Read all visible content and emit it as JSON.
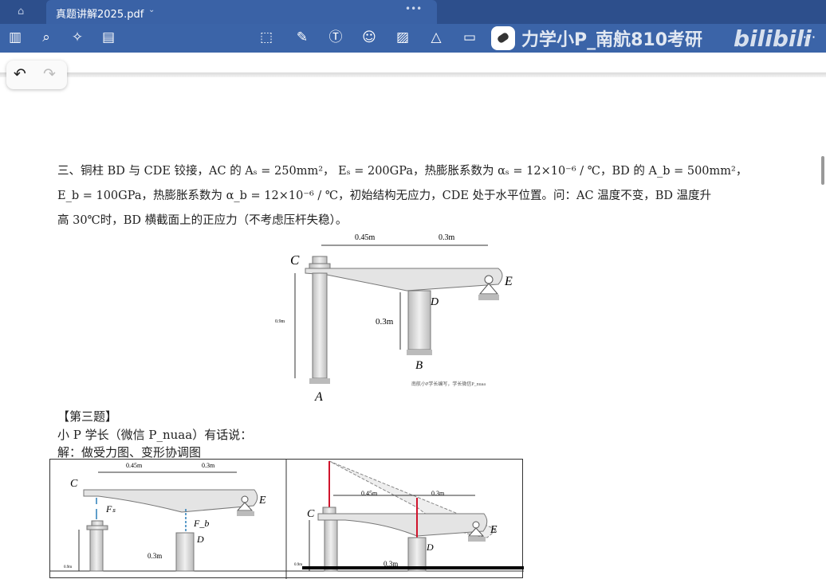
{
  "tabbar": {
    "tab_title": "真题讲解2025.pdf",
    "tab_chevron": "⌄",
    "more": "•••"
  },
  "watermark": {
    "text": "力学小P_南航810考研",
    "logo": "bilibili"
  },
  "question": {
    "line1": "三、铜柱 BD 与 CDE 铰接，AC 的 Aₛ = 250mm²， Eₛ = 200GPa，热膨胀系数为 αₛ = 12×10⁻⁶ / ℃，BD 的 A_b = 500mm²，",
    "line2": "E_b = 100GPa，热膨胀系数为 α_b = 12×10⁻⁶ / ℃，初始结构无应力，CDE 处于水平位置。问：AC 温度不变，BD 温度升",
    "line3": "高 30℃时，BD 横截面上的正应力（不考虑压杆失稳）。"
  },
  "figure": {
    "dim_ce": "0.45m",
    "dim_de": "0.3m",
    "dim_ac": "0.9m",
    "dim_bd": "0.3m",
    "C": "C",
    "D": "D",
    "E": "E",
    "A": "A",
    "B": "B",
    "credit": "南航小P学长编写，学长微信P_nuaa"
  },
  "solution": {
    "heading": "【第三题】",
    "intro": "小 P 学长（微信 P_nuaa）有话说：",
    "step": "解：做受力图、变形协调图"
  },
  "solution_figs": {
    "Fs": "Fₛ",
    "Fb": "F_b",
    "dim1": "0.45m",
    "dim2": "0.3m",
    "dim3": "0.3m",
    "dim4": "0.9m"
  }
}
